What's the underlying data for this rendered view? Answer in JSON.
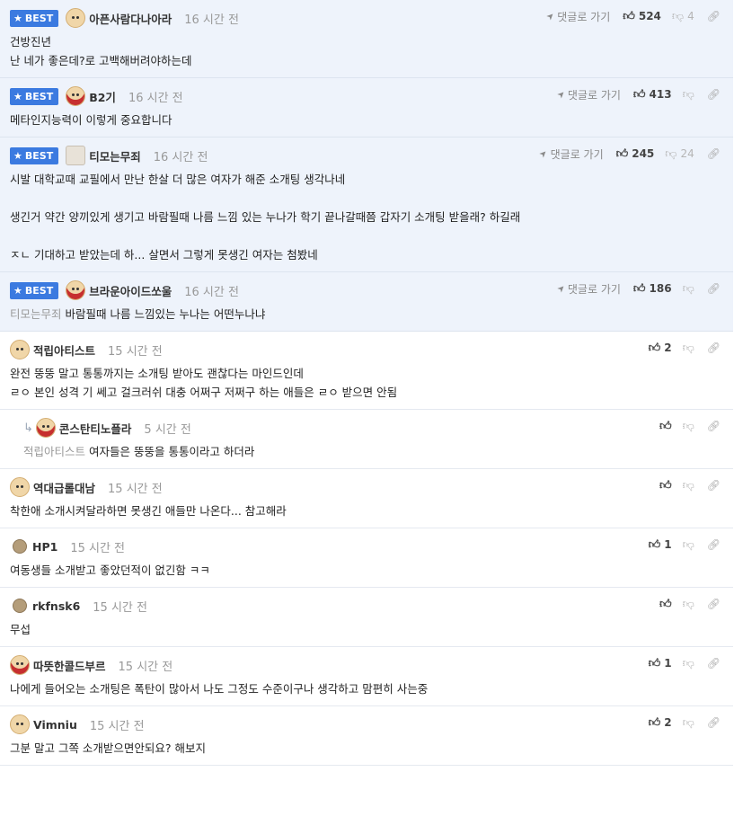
{
  "labels": {
    "best": "BEST",
    "goto_reply": "댓글로 가기"
  },
  "colors": {
    "best_badge": "#3b7ae0",
    "best_bg": "#eef3fb"
  },
  "comments": [
    {
      "best": true,
      "avatar": "puppy",
      "nick": "아픈사람다나아라",
      "time": "16 시간 전",
      "up": "524",
      "down": "4",
      "lines": [
        "건방진년",
        "난 네가 좋은데?로 고백해버려야하는데"
      ]
    },
    {
      "best": true,
      "avatar": "puppy-red",
      "nick": "B2기",
      "time": "16 시간 전",
      "up": "413",
      "down": "",
      "lines": [
        "메타인지능력이 이렇게 중요합니다"
      ]
    },
    {
      "best": true,
      "avatar": "wolf",
      "nick": "티모는무죄",
      "time": "16 시간 전",
      "up": "245",
      "down": "24",
      "lines": [
        "시발 대학교때 교필에서 만난 한살 더 많은 여자가 해준 소개팅 생각나네",
        "",
        "생긴거 약간 양끼있게 생기고 바람필때 나름 느낌 있는 누나가 학기 끝나갈때쯤 갑자기 소개팅 받을래? 하길래",
        "",
        "ㅈㄴ 기대하고 받았는데 하... 살면서 그렇게 못생긴 여자는 첨봤네"
      ]
    },
    {
      "best": true,
      "avatar": "puppy-red",
      "nick": "브라운아이드쏘울",
      "time": "16 시간 전",
      "up": "186",
      "down": "",
      "mention": "티모는무죄",
      "lines": [
        "바람필때 나름 느낌있는 누나는 어떤누나냐"
      ]
    },
    {
      "best": false,
      "avatar": "puppy",
      "nick": "적립아티스트",
      "time": "15 시간 전",
      "up": "2",
      "down": "",
      "lines": [
        "완전 뚱뚱 말고 통통까지는 소개팅 받아도 괜찮다는 마인드인데",
        "ㄹㅇ 본인 성격 기 쎄고 걸크러쉬 대충 어쩌구 저쩌구 하는 애들은 ㄹㅇ 받으면 안됨"
      ]
    },
    {
      "best": false,
      "reply": true,
      "avatar": "puppy-red",
      "nick": "콘스탄티노플라",
      "time": "5 시간 전",
      "up": "",
      "down": "",
      "mention": "적립아티스트",
      "lines": [
        "여자들은 뚱뚱을 통통이라고 하더라"
      ]
    },
    {
      "best": false,
      "avatar": "puppy",
      "nick": "역대급롤대남",
      "time": "15 시간 전",
      "up": "",
      "down": "",
      "lines": [
        "착한애 소개시켜달라하면 못생긴 애들만 나온다... 참고해라"
      ]
    },
    {
      "best": false,
      "avatar": "dot",
      "nick": "HP1",
      "time": "15 시간 전",
      "up": "1",
      "down": "",
      "lines": [
        "여동생들 소개받고 좋았던적이 없긴함 ㅋㅋ"
      ]
    },
    {
      "best": false,
      "avatar": "dot",
      "nick": "rkfnsk6",
      "time": "15 시간 전",
      "up": "",
      "down": "",
      "lines": [
        "무섭"
      ]
    },
    {
      "best": false,
      "avatar": "puppy-red",
      "nick": "따뜻한콜드부르",
      "time": "15 시간 전",
      "up": "1",
      "down": "",
      "lines": [
        "나에게 들어오는 소개팅은 폭탄이 많아서 나도 그정도 수준이구나 생각하고 맘편히 사는중"
      ]
    },
    {
      "best": false,
      "avatar": "puppy",
      "nick": "Vimniu",
      "time": "15 시간 전",
      "up": "2",
      "down": "",
      "lines": [
        "그분 말고 그쪽 소개받으면안되요? 해보지"
      ]
    }
  ]
}
